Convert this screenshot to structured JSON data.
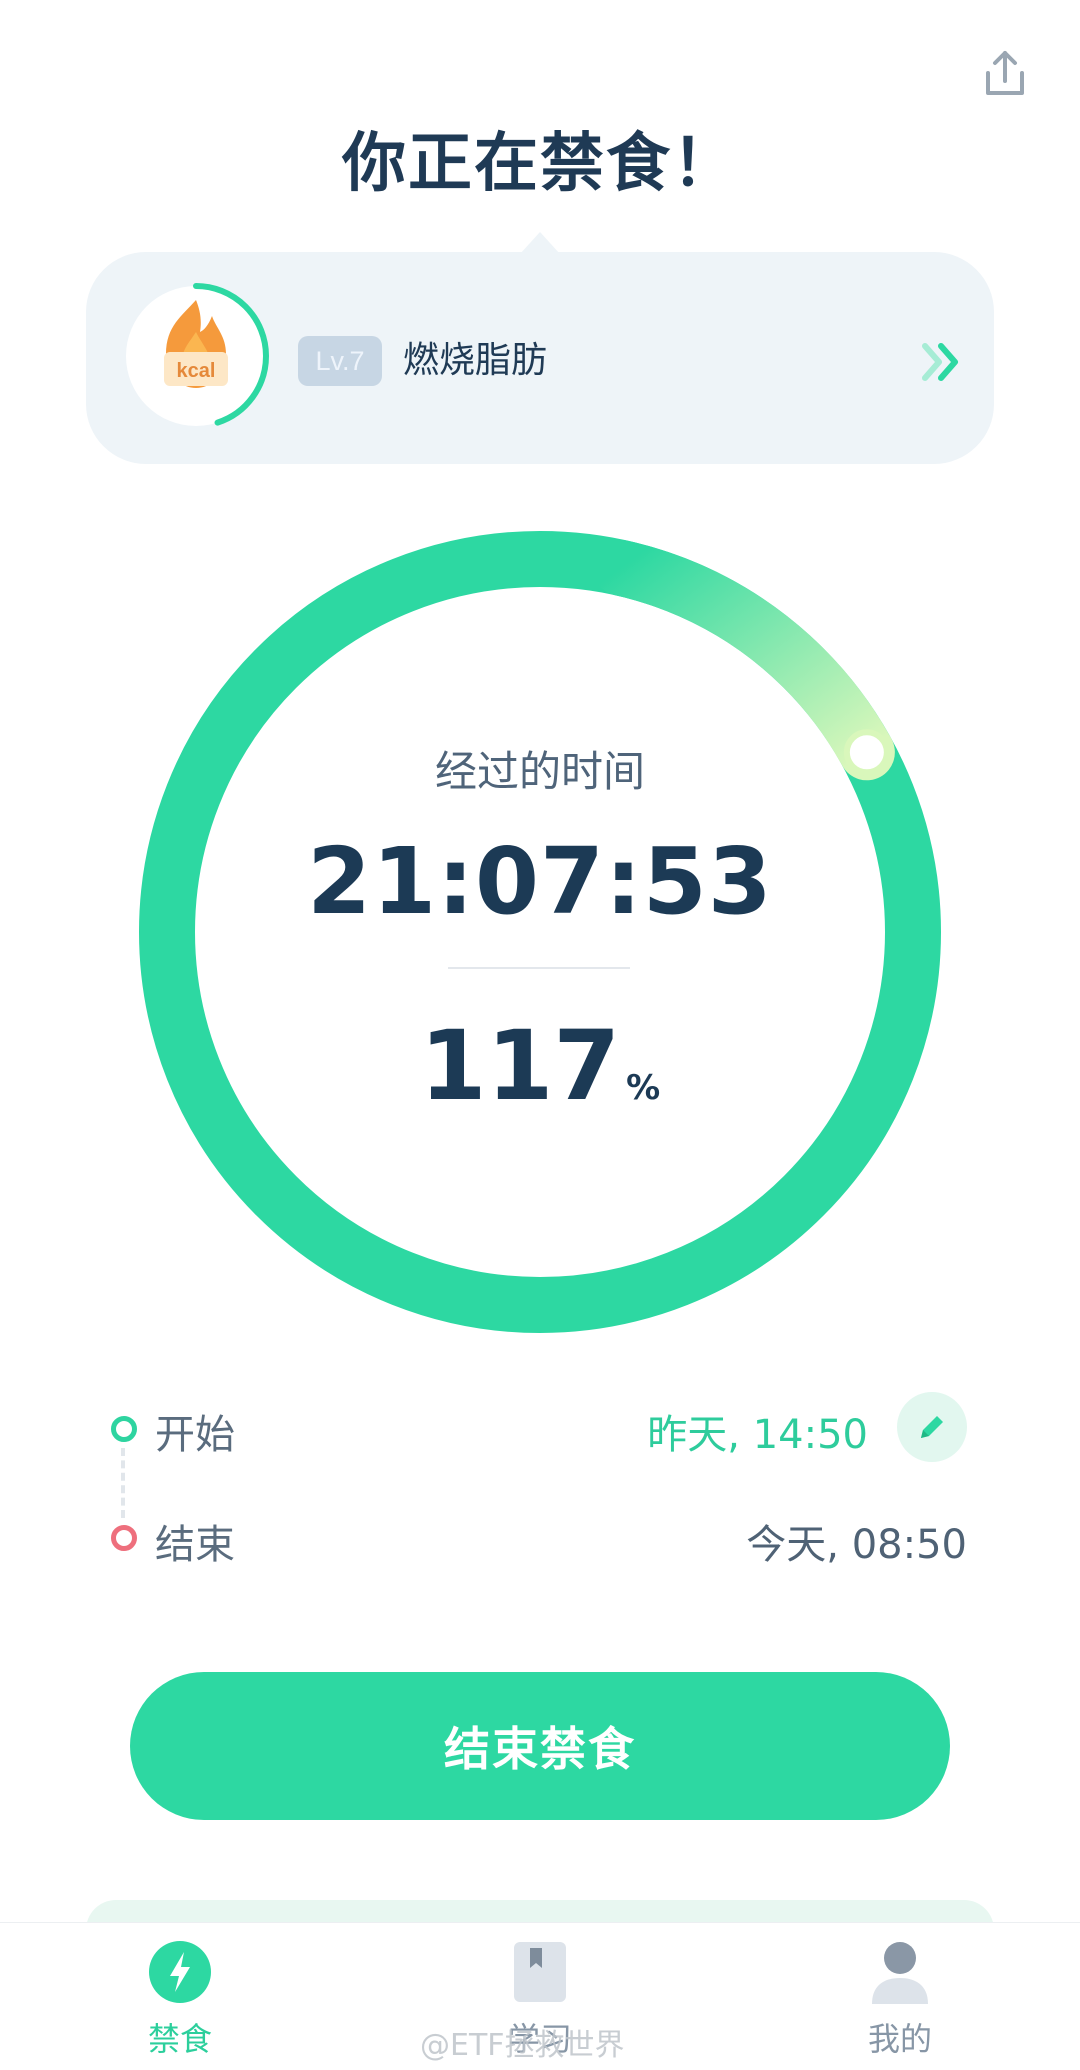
{
  "header": {
    "title": "你正在禁食！",
    "share_icon": "share-upload-icon"
  },
  "stage_card": {
    "badge_text": "kcal",
    "badge_icon": "flame-icon",
    "level": "Lv.7",
    "stage_name": "燃烧脂肪",
    "level_progress": 0.45,
    "more_icon": "double-chevron-right-icon"
  },
  "timer": {
    "label": "经过的时间",
    "elapsed": "21:07:53",
    "percent": "117",
    "percent_sign": "%",
    "progress": 1.17
  },
  "schedule": {
    "start_label": "开始",
    "start_value": "昨天, 14:50",
    "end_label": "结束",
    "end_value": "今天, 08:50",
    "edit_icon": "pencil-icon"
  },
  "actions": {
    "end_fast": "结束禁食"
  },
  "nav": {
    "items": [
      {
        "label": "禁食",
        "icon": "lightning-icon",
        "active": true
      },
      {
        "label": "学习",
        "icon": "book-icon",
        "active": false
      },
      {
        "label": "我的",
        "icon": "user-icon",
        "active": false
      }
    ]
  },
  "watermark": "@ETF拯救世界",
  "colors": {
    "accent": "#2dd8a2",
    "title": "#1f3a55",
    "card_bg": "#eef4f8",
    "end_dot": "#ee6f7d"
  }
}
